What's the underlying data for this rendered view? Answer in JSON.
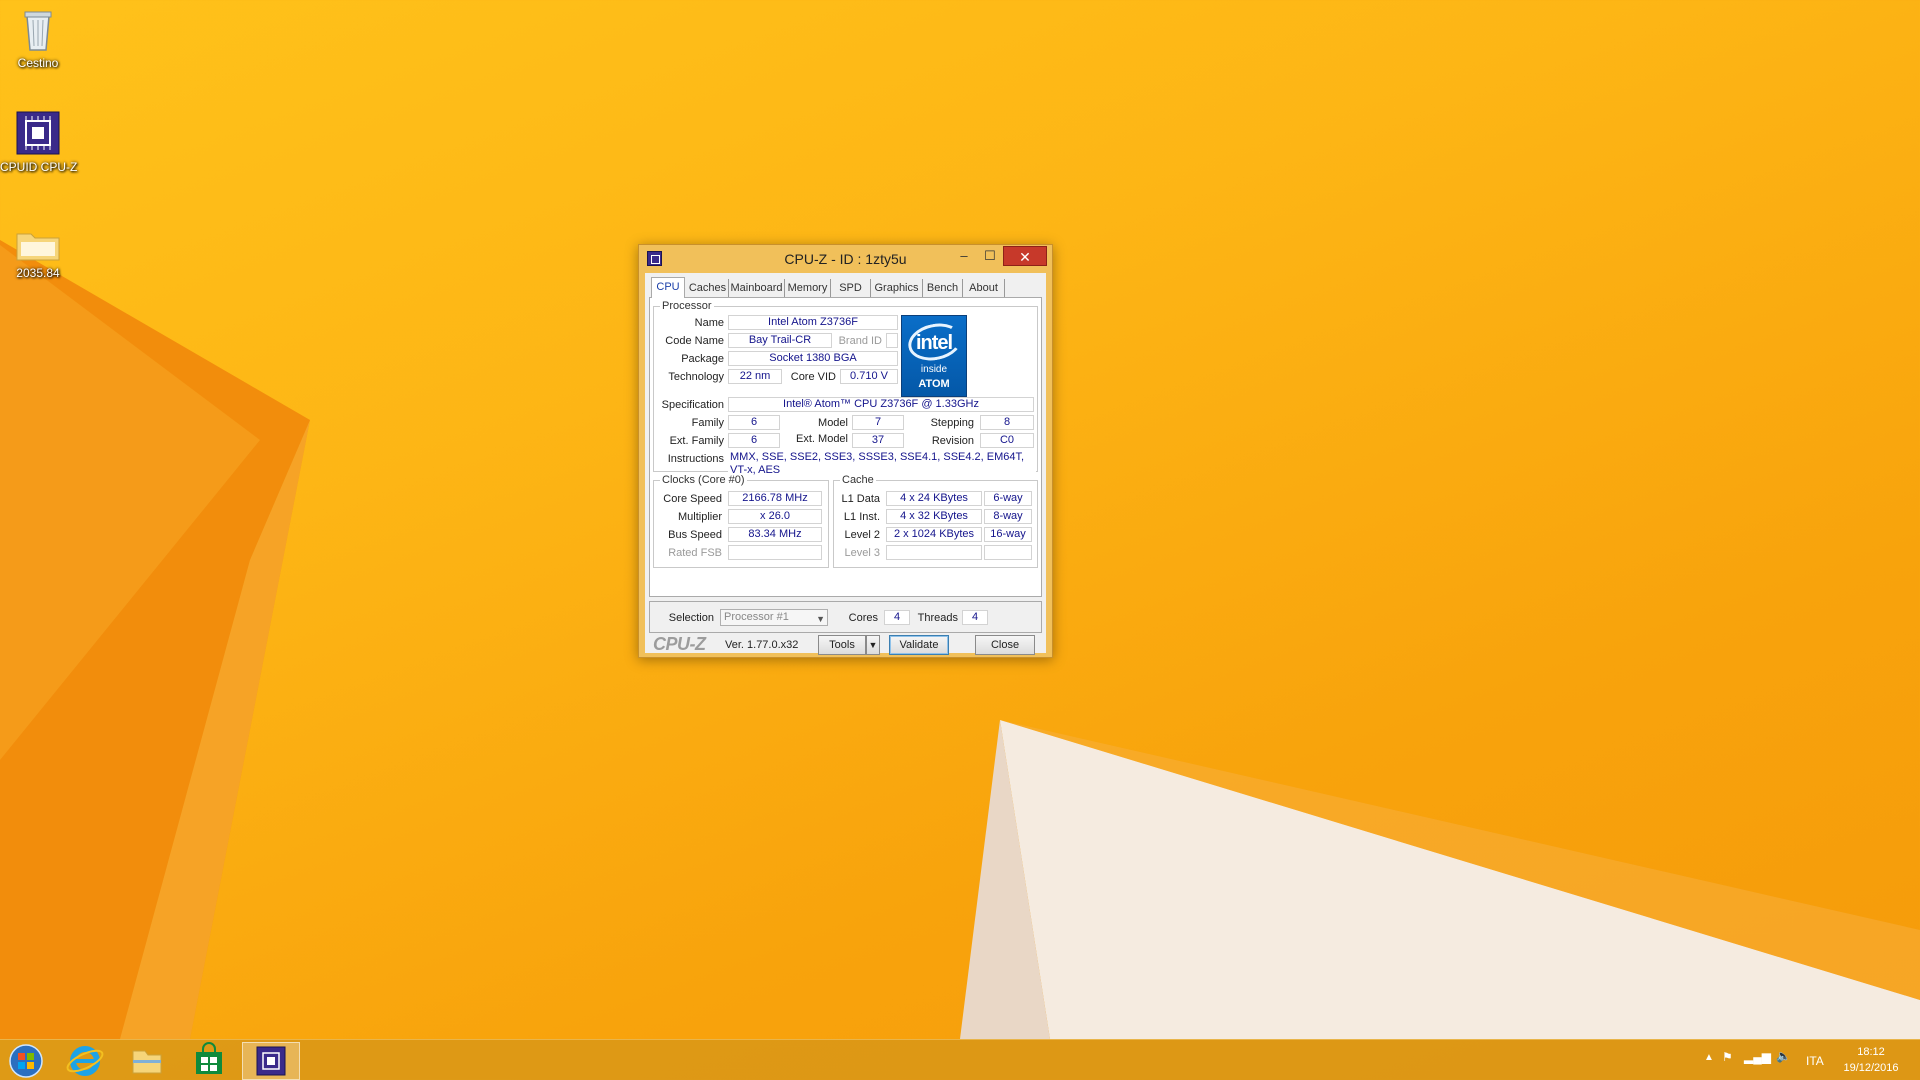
{
  "desktop": {
    "icons": [
      {
        "label": "Cestino",
        "icon": "recycle-bin-icon"
      },
      {
        "label": "CPUID CPU-Z",
        "icon": "cpuz-icon"
      },
      {
        "label": "2035.84",
        "icon": "folder-icon"
      }
    ]
  },
  "window": {
    "title": "CPU-Z  -  ID : 1zty5u",
    "controls": {
      "minimize": "–",
      "maximize": "☐",
      "close": "✕"
    },
    "tabs": [
      {
        "label": "CPU",
        "active": true
      },
      {
        "label": "Caches"
      },
      {
        "label": "Mainboard"
      },
      {
        "label": "Memory"
      },
      {
        "label": "SPD"
      },
      {
        "label": "Graphics"
      },
      {
        "label": "Bench"
      },
      {
        "label": "About"
      }
    ],
    "processor": {
      "group_label": "Processor",
      "name_label": "Name",
      "name": "Intel Atom Z3736F",
      "codename_label": "Code Name",
      "codename": "Bay Trail-CR",
      "brandid_label": "Brand ID",
      "brandid": "",
      "package_label": "Package",
      "package": "Socket 1380 BGA",
      "technology_label": "Technology",
      "technology": "22 nm",
      "corevid_label": "Core VID",
      "corevid": "0.710 V",
      "spec_label": "Specification",
      "spec": "Intel® Atom™ CPU  Z3736F @ 1.33GHz",
      "family_label": "Family",
      "family": "6",
      "model_label": "Model",
      "model": "7",
      "stepping_label": "Stepping",
      "stepping": "8",
      "extfamily_label": "Ext. Family",
      "extfamily": "6",
      "extmodel_label": "Ext. Model",
      "extmodel": "37",
      "revision_label": "Revision",
      "revision": "C0",
      "instructions_label": "Instructions",
      "instructions": "MMX, SSE, SSE2, SSE3, SSSE3, SSE4.1, SSE4.2, EM64T, VT-x, AES",
      "logo": {
        "brand": "intel",
        "line1": "inside",
        "line2": "ATOM"
      }
    },
    "clocks": {
      "group_label": "Clocks (Core #0)",
      "corespeed_label": "Core Speed",
      "corespeed": "2166.78 MHz",
      "multiplier_label": "Multiplier",
      "multiplier": "x 26.0",
      "busspeed_label": "Bus Speed",
      "busspeed": "83.34 MHz",
      "ratedfsb_label": "Rated FSB",
      "ratedfsb": ""
    },
    "cache": {
      "group_label": "Cache",
      "l1data_label": "L1 Data",
      "l1data": "4 x 24 KBytes",
      "l1data_way": "6-way",
      "l1inst_label": "L1 Inst.",
      "l1inst": "4 x 32 KBytes",
      "l1inst_way": "8-way",
      "level2_label": "Level 2",
      "level2": "2 x 1024 KBytes",
      "level2_way": "16-way",
      "level3_label": "Level 3",
      "level3": "",
      "level3_way": ""
    },
    "selection": {
      "label": "Selection",
      "value": "Processor #1",
      "cores_label": "Cores",
      "cores": "4",
      "threads_label": "Threads",
      "threads": "4"
    },
    "footer": {
      "brand": "CPU-Z",
      "version": "Ver. 1.77.0.x32",
      "tools": "Tools",
      "validate": "Validate",
      "close": "Close"
    }
  },
  "taskbar": {
    "items": [
      "start-icon",
      "internet-explorer-icon",
      "file-explorer-icon",
      "store-icon",
      "cpuz-icon"
    ],
    "language": "ITA",
    "time": "18:12",
    "date": "19/12/2016"
  },
  "colors": {
    "desktop": "#fdb515",
    "window_frame": "#f1c05a",
    "value_text": "#14148c",
    "close_red": "#c7392a"
  }
}
